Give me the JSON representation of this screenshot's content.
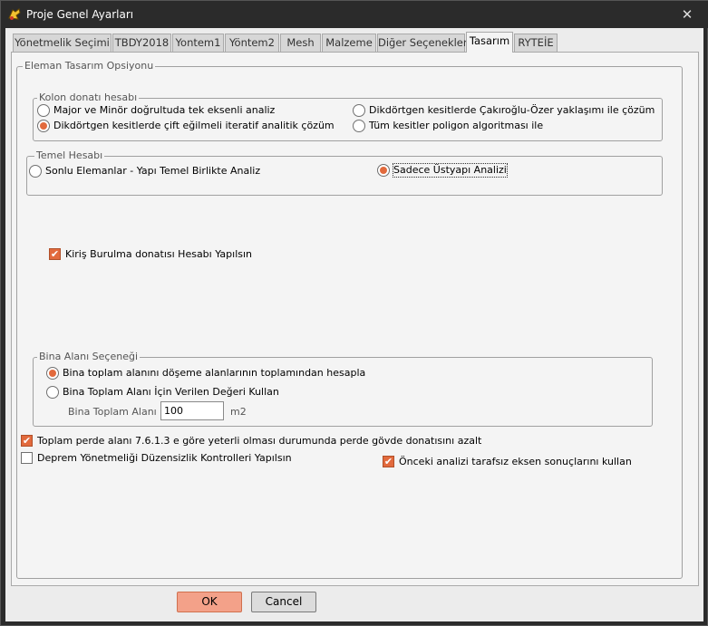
{
  "window": {
    "title": "Proje Genel Ayarları",
    "close": "✕"
  },
  "tabs": [
    {
      "label": "Yönetmelik Seçimi",
      "active": false
    },
    {
      "label": "TBDY2018",
      "active": false
    },
    {
      "label": "Yontem1",
      "active": false
    },
    {
      "label": "Yöntem2",
      "active": false
    },
    {
      "label": "Mesh",
      "active": false
    },
    {
      "label": "Malzeme",
      "active": false
    },
    {
      "label": "Diğer Seçenekler",
      "active": false
    },
    {
      "label": "Tasarım",
      "active": true
    },
    {
      "label": "RYTEİE",
      "active": false
    }
  ],
  "design": {
    "legend": "Eleman Tasarım Opsiyonu",
    "column": {
      "legend": "Kolon donatı hesabı",
      "opt1": "Major ve Minör doğrultuda tek eksenli analiz",
      "opt2": "Dikdörtgen kesitlerde çift eğilmeli iteratif analitik çözüm",
      "opt3": "Dikdörtgen kesitlerde Çakıroğlu-Özer yaklaşımı ile çözüm",
      "opt4": "Tüm kesitler poligon algoritması ile",
      "selected": "opt2"
    },
    "foundation": {
      "legend": "Temel Hesabı",
      "opt1": "Sonlu Elemanlar - Yapı Temel Birlikte Analiz",
      "opt2": "Sadece Üstyapı Analizi",
      "selected": "opt2"
    },
    "torsion": {
      "label": "Kiriş Burulma donatısı Hesabı Yapılsın",
      "checked": true
    },
    "building_area": {
      "legend": "Bina Alanı Seçeneği",
      "opt1": "Bina toplam alanını döşeme alanlarının toplamından hesapla",
      "opt2": "Bina Toplam Alanı İçin Verilen Değeri Kullan",
      "selected": "opt1",
      "area_label": "Bina Toplam Alanı",
      "area_value": "100",
      "unit": "m2"
    },
    "shear_wall": {
      "label": "Toplam perde alanı 7.6.1.3 e göre yeterli olması durumunda perde gövde donatısını azalt",
      "checked": true
    },
    "irregularity": {
      "label": "Deprem Yönetmeliği Düzensizlik Kontrolleri Yapılsın",
      "checked": false
    },
    "previous": {
      "label": "Önceki analizi tarafsız eksen sonuçlarını kullan",
      "checked": true
    }
  },
  "buttons": {
    "ok": "OK",
    "cancel": "Cancel"
  },
  "check_mark": "✔"
}
